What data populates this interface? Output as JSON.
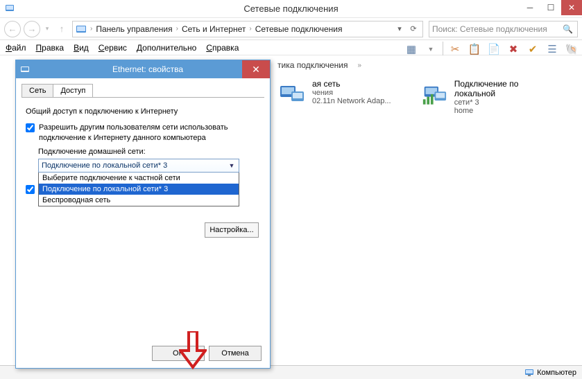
{
  "window": {
    "title": "Сетевые подключения"
  },
  "wincontrols": {
    "min": "─",
    "max": "☐",
    "close": "✕"
  },
  "nav": {
    "back": "←",
    "forward": "→",
    "dropdown": "▾",
    "up": "↑",
    "refresh": "⟳",
    "chev": "▾"
  },
  "breadcrumb": {
    "items": [
      "Панель управления",
      "Сеть и Интернет",
      "Сетевые подключения"
    ],
    "sep": "›"
  },
  "search": {
    "placeholder": "Поиск: Сетевые подключения",
    "icon": "🔍"
  },
  "menubar": [
    "Файл",
    "Правка",
    "Вид",
    "Сервис",
    "Дополнительно",
    "Справка"
  ],
  "toolbar": {
    "disable": "тика подключения",
    "chev": "»"
  },
  "connections": {
    "c1": {
      "line1": "ая сеть",
      "line2": "чения",
      "line3": "02.11n Network Adap..."
    },
    "c2": {
      "line1": "Подключение по локальной",
      "line2": "сети* 3",
      "line3": "home"
    }
  },
  "statusbar": {
    "computer": "Компьютер"
  },
  "dialog": {
    "title": "Ethernet: свойства",
    "tabs": {
      "t1": "Сеть",
      "t2": "Доступ"
    },
    "section_title": "Общий доступ к подключению к Интернету",
    "chk1_label": "Разрешить другим пользователям сети использовать подключение к Интернету данного компьютера",
    "chk1_checked": true,
    "home_label": "Подключение домашней сети:",
    "combo_value": "Подключение по локальной сети* 3",
    "dropdown": {
      "opt1": "Выберите подключение к частной сети",
      "opt2": "Подключение по локальной сети* 3",
      "opt3": "Беспроводная сеть"
    },
    "chk2_checked": true,
    "settings_btn": "Настройка...",
    "ok": "OK",
    "cancel": "Отмена"
  },
  "icons": {
    "shell": "🐚",
    "scissors": "✂",
    "copy": "📋",
    "paste": "📄",
    "delete": "✖",
    "check": "✔",
    "props": "☰"
  }
}
